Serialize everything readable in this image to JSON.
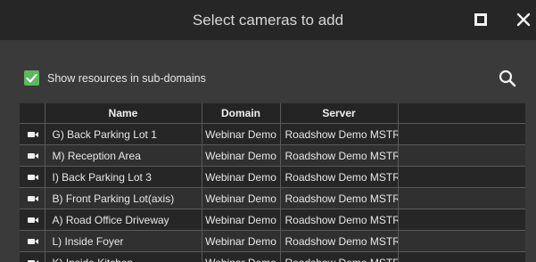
{
  "dialog": {
    "title": "Select cameras to add",
    "maximize_icon": "maximize-icon",
    "close_icon": "close-icon",
    "accent_color": "#5cb85c"
  },
  "options": {
    "sub_domains_label": "Show resources in sub-domains",
    "sub_domains_checked": true,
    "search_icon": "search-icon"
  },
  "table": {
    "columns": [
      "",
      "Name",
      "Domain",
      "Server",
      ""
    ],
    "rows": [
      {
        "icon": "camera-icon",
        "name": "G) Back Parking Lot 1",
        "domain": "Webinar Demo",
        "server": "Roadshow Demo MSTR"
      },
      {
        "icon": "camera-icon",
        "name": "M) Reception Area",
        "domain": "Webinar Demo",
        "server": "Roadshow Demo MSTR"
      },
      {
        "icon": "camera-icon",
        "name": "I) Back Parking Lot 3",
        "domain": "Webinar Demo",
        "server": "Roadshow Demo MSTR"
      },
      {
        "icon": "camera-icon",
        "name": "B) Front Parking Lot(axis)",
        "domain": "Webinar Demo",
        "server": "Roadshow Demo MSTR"
      },
      {
        "icon": "camera-icon",
        "name": "A) Road Office Driveway",
        "domain": "Webinar Demo",
        "server": "Roadshow Demo MSTR"
      },
      {
        "icon": "camera-icon",
        "name": "L) Inside Foyer",
        "domain": "Webinar Demo",
        "server": "Roadshow Demo MSTR"
      },
      {
        "icon": "camera-icon",
        "name": "K) Inside Kitchen",
        "domain": "Webinar Demo",
        "server": "Roadshow Demo MSTR"
      }
    ]
  }
}
